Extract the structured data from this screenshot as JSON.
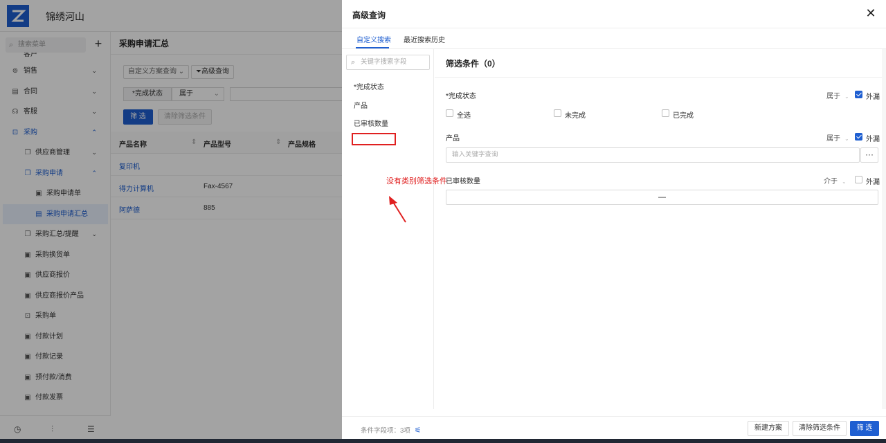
{
  "app": {
    "name": "锦绣河山"
  },
  "sidebar": {
    "search_placeholder": "搜索菜单",
    "partial_item": "客户",
    "items": [
      {
        "label": "销售",
        "icon": "sales-icon"
      },
      {
        "label": "合同",
        "icon": "contract-icon"
      },
      {
        "label": "客服",
        "icon": "headset-icon"
      },
      {
        "label": "采购",
        "icon": "cart-icon"
      },
      {
        "label": "供应商管理",
        "icon": "supplier-icon"
      },
      {
        "label": "采购申请",
        "icon": "request-icon"
      },
      {
        "label": "采购申请单",
        "icon": "doc-icon"
      },
      {
        "label": "采购申请汇总",
        "icon": "summary-icon"
      },
      {
        "label": "采购汇总/提醒",
        "icon": "reminder-icon"
      },
      {
        "label": "采购换货单",
        "icon": "exchange-icon"
      },
      {
        "label": "供应商报价",
        "icon": "quote-icon"
      },
      {
        "label": "供应商报价产品",
        "icon": "quote-product-icon"
      },
      {
        "label": "采购单",
        "icon": "order-icon"
      },
      {
        "label": "付款计划",
        "icon": "plan-icon"
      },
      {
        "label": "付款记录",
        "icon": "record-icon"
      },
      {
        "label": "预付款/消费",
        "icon": "prepay-icon"
      },
      {
        "label": "付款发票",
        "icon": "invoice-icon"
      }
    ]
  },
  "main": {
    "title": "采购申请汇总",
    "custom_query": "自定义方案查询",
    "advanced_query": "高级查询",
    "filter_label": "*完成状态",
    "filter_op": "属于",
    "filter_button": "筛 选",
    "clear_button": "清除筛选条件",
    "columns": [
      "产品名称",
      "产品型号",
      "产品规格"
    ],
    "rows": [
      {
        "name": "复印机",
        "model": ""
      },
      {
        "name": "得力计算机",
        "model": "Fax-4567"
      },
      {
        "name": "阿萨德",
        "model": "885"
      }
    ]
  },
  "drawer": {
    "title": "高级查询",
    "tabs": [
      "自定义搜索",
      "最近搜索历史"
    ],
    "field_search_placeholder": "关键字搜索字段",
    "fields": [
      "*完成状态",
      "产品",
      "已审核数量"
    ],
    "annotation": "没有类别筛选条件",
    "condition_title": "筛选条件（0）",
    "conditions": {
      "status": {
        "label": "*完成状态",
        "op": "属于",
        "omit": "外漏",
        "options": [
          "全选",
          "未完成",
          "已完成"
        ]
      },
      "product": {
        "label": "产品",
        "op": "属于",
        "omit": "外漏",
        "placeholder": "输入关键字查询",
        "more": "···"
      },
      "qty": {
        "label": "已审核数量",
        "op": "介于",
        "omit": "外漏",
        "separator": "—"
      }
    },
    "footer": {
      "count": "条件字段项：3项",
      "new_plan": "新建方案",
      "clear": "清除筛选条件",
      "filter": "筛 选"
    }
  },
  "colors": {
    "accent": "#1f5fd1",
    "annotation": "#e02020"
  }
}
